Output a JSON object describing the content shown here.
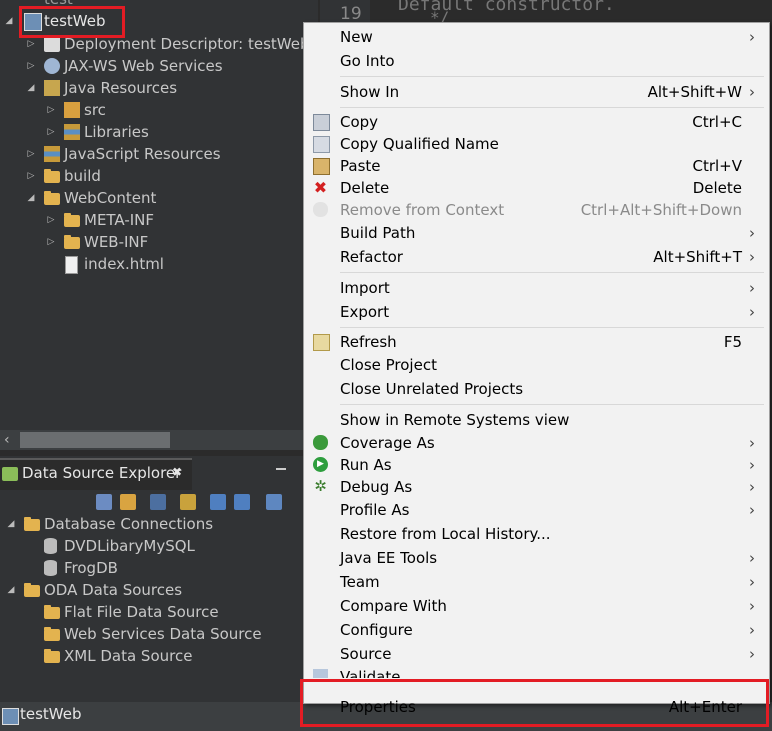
{
  "explorer": {
    "cut_top_label": "test",
    "project": "testWeb",
    "items": [
      {
        "label": "Deployment Descriptor: testWeb"
      },
      {
        "label": "JAX-WS Web Services"
      },
      {
        "label": "Java Resources"
      },
      {
        "label": "src"
      },
      {
        "label": "Libraries"
      },
      {
        "label": "JavaScript Resources"
      },
      {
        "label": "build"
      },
      {
        "label": "WebContent"
      },
      {
        "label": "META-INF"
      },
      {
        "label": "WEB-INF"
      },
      {
        "label": "index.html"
      }
    ]
  },
  "data_source_explorer": {
    "tab_title": "Data Source Explorer",
    "close_glyph": "✖",
    "items": [
      {
        "label": "Database Connections"
      },
      {
        "label": "DVDLibaryMySQL"
      },
      {
        "label": "FrogDB"
      },
      {
        "label": "ODA Data Sources"
      },
      {
        "label": "Flat File Data Source"
      },
      {
        "label": "Web Services Data Source"
      },
      {
        "label": "XML Data Source"
      }
    ]
  },
  "status_bar": {
    "label": "testWeb"
  },
  "editor": {
    "line_numbers": [
      "19"
    ],
    "code_line_1": "Default constructor.",
    "code_line_2": "*/"
  },
  "context_menu": {
    "items": [
      {
        "label": "New",
        "shortcut": "",
        "submenu": true
      },
      {
        "label": "Go Into",
        "shortcut": "",
        "submenu": false
      },
      {
        "label": "Show In",
        "shortcut": "Alt+Shift+W",
        "submenu": true
      },
      {
        "label": "Copy",
        "shortcut": "Ctrl+C",
        "submenu": false
      },
      {
        "label": "Copy Qualified Name",
        "shortcut": "",
        "submenu": false
      },
      {
        "label": "Paste",
        "shortcut": "Ctrl+V",
        "submenu": false
      },
      {
        "label": "Delete",
        "shortcut": "Delete",
        "submenu": false
      },
      {
        "label": "Remove from Context",
        "shortcut": "Ctrl+Alt+Shift+Down",
        "submenu": false,
        "disabled": true
      },
      {
        "label": "Build Path",
        "shortcut": "",
        "submenu": true
      },
      {
        "label": "Refactor",
        "shortcut": "Alt+Shift+T",
        "submenu": true
      },
      {
        "label": "Import",
        "shortcut": "",
        "submenu": true
      },
      {
        "label": "Export",
        "shortcut": "",
        "submenu": true
      },
      {
        "label": "Refresh",
        "shortcut": "F5",
        "submenu": false
      },
      {
        "label": "Close Project",
        "shortcut": "",
        "submenu": false
      },
      {
        "label": "Close Unrelated Projects",
        "shortcut": "",
        "submenu": false
      },
      {
        "label": "Show in Remote Systems view",
        "shortcut": "",
        "submenu": false
      },
      {
        "label": "Coverage As",
        "shortcut": "",
        "submenu": true
      },
      {
        "label": "Run As",
        "shortcut": "",
        "submenu": true
      },
      {
        "label": "Debug As",
        "shortcut": "",
        "submenu": true
      },
      {
        "label": "Profile As",
        "shortcut": "",
        "submenu": true
      },
      {
        "label": "Restore from Local History...",
        "shortcut": "",
        "submenu": false
      },
      {
        "label": "Java EE Tools",
        "shortcut": "",
        "submenu": true
      },
      {
        "label": "Team",
        "shortcut": "",
        "submenu": true
      },
      {
        "label": "Compare With",
        "shortcut": "",
        "submenu": true
      },
      {
        "label": "Configure",
        "shortcut": "",
        "submenu": true
      },
      {
        "label": "Source",
        "shortcut": "",
        "submenu": true
      },
      {
        "label": "Validate",
        "shortcut": "",
        "submenu": false
      },
      {
        "label": "Properties",
        "shortcut": "Alt+Enter",
        "submenu": false
      }
    ],
    "arrow_glyph": "›"
  },
  "colors": {
    "highlight_box": "#e31c24",
    "menu_bg": "#f2f2f2",
    "panel_bg": "#313335"
  }
}
